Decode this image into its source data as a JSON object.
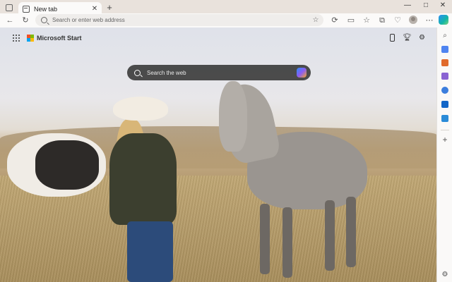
{
  "window": {
    "tab_title": "New tab",
    "tab_close": "✕",
    "new_tab": "+",
    "minimize": "—",
    "maximize": "□",
    "close": "✕"
  },
  "toolbar": {
    "back": "←",
    "refresh": "↻",
    "address_placeholder": "Search or enter web address",
    "favorite": "☆",
    "more": "⋯"
  },
  "page": {
    "brand": "Microsoft Start",
    "search_placeholder": "Search the web"
  },
  "sidebar": {
    "add": "+",
    "settings": "⚙"
  },
  "colors": {
    "accent": "#2b8ff5",
    "ms_red": "#f25022",
    "ms_green": "#7fba00",
    "ms_blue": "#00a4ef",
    "ms_yellow": "#ffb900"
  }
}
